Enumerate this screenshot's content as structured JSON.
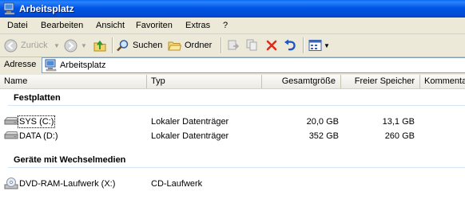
{
  "window": {
    "title": "Arbeitsplatz"
  },
  "menu": [
    "Datei",
    "Bearbeiten",
    "Ansicht",
    "Favoriten",
    "Extras",
    "?"
  ],
  "toolbar": {
    "back_label": "Zurück",
    "search_label": "Suchen",
    "folders_label": "Ordner"
  },
  "address": {
    "label": "Adresse",
    "value": "Arbeitsplatz"
  },
  "columns": {
    "name": "Name",
    "type": "Typ",
    "total": "Gesamtgröße",
    "free": "Freier Speicher",
    "comment": "Kommentar"
  },
  "groups": [
    {
      "title": "Festplatten",
      "items": [
        {
          "name": "SYS (C:)",
          "type": "Lokaler Datenträger",
          "total": "20,0 GB",
          "free": "13,1 GB",
          "icon": "hard-drive-icon"
        },
        {
          "name": "DATA (D:)",
          "type": "Lokaler Datenträger",
          "total": "352 GB",
          "free": "260 GB",
          "icon": "hard-drive-icon"
        }
      ]
    },
    {
      "title": "Geräte mit Wechselmedien",
      "items": [
        {
          "name": "DVD-RAM-Laufwerk (X:)",
          "type": "CD-Laufwerk",
          "total": "",
          "free": "",
          "icon": "cd-drive-icon"
        }
      ]
    }
  ],
  "colors": {
    "titlebar": "#0055e5",
    "window_bg": "#ece9d8",
    "list_bg": "#ffffff",
    "group_line": "#d7e3f7"
  }
}
